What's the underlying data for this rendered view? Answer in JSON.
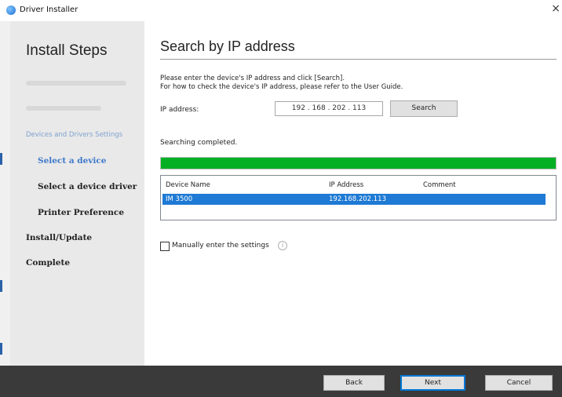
{
  "window": {
    "title": "Driver Installer",
    "close_glyph": "×"
  },
  "sidebar": {
    "title": "Install Steps",
    "group_label": "Devices and Drivers Settings",
    "steps": {
      "select_device": "Select a device",
      "select_driver": "Select a device driver",
      "printer_pref": "Printer Preference",
      "install_update": "Install/Update",
      "complete": "Complete"
    }
  },
  "main": {
    "title": "Search by IP address",
    "instructions": [
      "Please enter the device's IP address and click [Search].",
      "For how to check the device's IP address, please refer to the User Guide."
    ],
    "ip_label": "IP address:",
    "ip_value": "192 . 168 . 202 . 113",
    "search_label": "Search",
    "status": "Searching completed.",
    "progress_fraction": 1.0,
    "table": {
      "columns": [
        "Device Name",
        "IP Address",
        "Comment"
      ],
      "rows": [
        {
          "device_name": "IM 3500",
          "ip_address": "192.168.202.113",
          "comment": ""
        }
      ]
    },
    "manual_label": "Manually enter the settings",
    "manual_checked": false,
    "info_glyph": "i"
  },
  "footer": {
    "back": "Back",
    "next": "Next",
    "cancel": "Cancel"
  },
  "colors": {
    "accent": "#3e79c9",
    "progress": "#06b025",
    "selection": "#1e7ad4",
    "footer": "#3a3a3a"
  }
}
